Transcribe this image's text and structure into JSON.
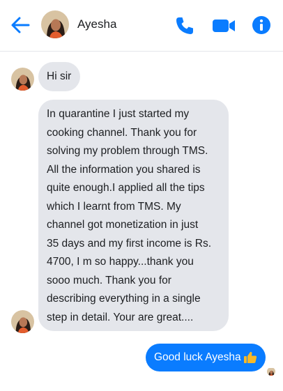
{
  "header": {
    "contact_name": "Ayesha",
    "back_icon": "arrow-left-icon",
    "call_icon": "phone-icon",
    "video_icon": "video-camera-icon",
    "info_icon": "info-icon"
  },
  "messages": [
    {
      "direction": "incoming",
      "text": "Hi sir"
    },
    {
      "direction": "incoming",
      "text": "In quarantine I just started my\ncooking channel. Thank you for\nsolving my problem through TMS.\nAll the information you shared is\nquite enough.I applied all the tips\nwhich I learnt from TMS. My\nchannel got monetization in just\n35 days and my first income is Rs.\n4700, I m so happy...thank you\nsooo much. Thank you for\ndescribing everything in a single\nstep in detail. Your are great...."
    },
    {
      "direction": "outgoing",
      "text": "Good luck Ayesha",
      "emoji_icon": "thumbs-up-icon"
    }
  ],
  "colors": {
    "accent": "#0a7cff",
    "incoming_bubble": "#e4e6eb",
    "thumb": "#f7b928"
  }
}
